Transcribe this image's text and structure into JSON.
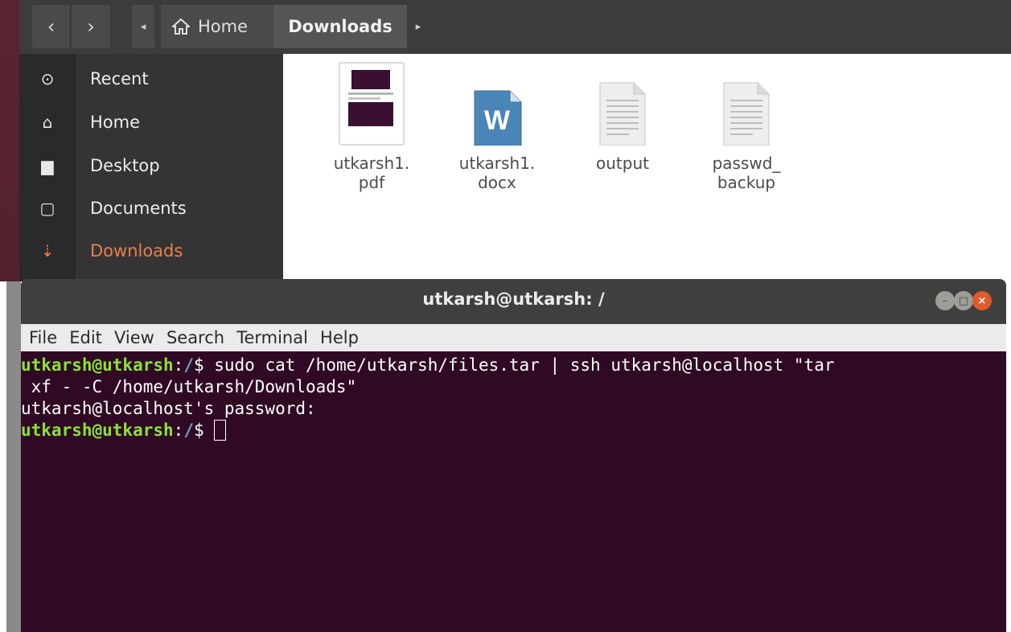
{
  "file_manager": {
    "nav": {
      "back_glyph": "‹",
      "forward_glyph": "›",
      "crumb_left_glyph": "◂",
      "crumb_right_glyph": "▸"
    },
    "breadcrumb": {
      "home_label": "Home",
      "current_label": "Downloads"
    },
    "sidebar": {
      "items": [
        {
          "label": "Recent",
          "icon": "clock-icon",
          "glyph": "⊙"
        },
        {
          "label": "Home",
          "icon": "home-icon",
          "glyph": "⌂"
        },
        {
          "label": "Desktop",
          "icon": "folder-icon",
          "glyph": "▆"
        },
        {
          "label": "Documents",
          "icon": "document-icon",
          "glyph": "▢"
        },
        {
          "label": "Downloads",
          "icon": "download-icon",
          "glyph": "⇣",
          "active": true
        }
      ]
    },
    "files": [
      {
        "name": "utkarsh1.\npdf",
        "type": "pdf"
      },
      {
        "name": "utkarsh1.\ndocx",
        "type": "docx",
        "badge": "W"
      },
      {
        "name": "output",
        "type": "text"
      },
      {
        "name": "passwd_\nbackup",
        "type": "text"
      }
    ]
  },
  "terminal": {
    "title": "utkarsh@utkarsh: /",
    "window_buttons": {
      "minimize": "–",
      "maximize": "□",
      "close": "×"
    },
    "menu": [
      "File",
      "Edit",
      "View",
      "Search",
      "Terminal",
      "Help"
    ],
    "lines": {
      "l1_user": "utkarsh@utkarsh",
      "l1_colon": ":",
      "l1_path": "/",
      "l1_cmd": "$ sudo cat /home/utkarsh/files.tar | ssh utkarsh@localhost \"tar",
      "l2": " xf - -C /home/utkarsh/Downloads\"",
      "l3": "utkarsh@localhost's password:",
      "l4_user": "utkarsh@utkarsh",
      "l4_colon": ":",
      "l4_path": "/",
      "l4_prompt": "$ "
    }
  },
  "colors": {
    "terminal_bg": "#300a24",
    "prompt_user": "#8ae234",
    "prompt_path": "#729fcf",
    "active_sidebar": "#e8804e",
    "close_button": "#e05a2b"
  }
}
